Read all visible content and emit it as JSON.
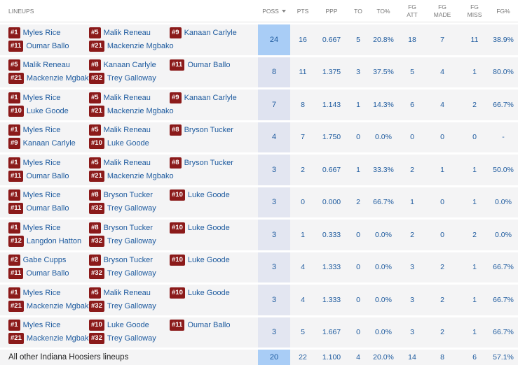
{
  "headers": {
    "lineups": "LINEUPS",
    "poss": "POSS",
    "pts": "PTS",
    "ppp": "PPP",
    "to": "TO",
    "to_pct": "TO%",
    "fg_att_1": "FG",
    "fg_att_2": "ATT",
    "fg_made_1": "FG",
    "fg_made_2": "MADE",
    "fg_miss_1": "FG",
    "fg_miss_2": "MISS",
    "fg_pct": "FG%"
  },
  "colors": {
    "badge": "#8b1a1a",
    "link": "#1d5a9e",
    "poss_highlight": "#a9cdf6",
    "poss_light": "#e6e8f2"
  },
  "lineups": [
    {
      "players": [
        {
          "num": "#1",
          "name": "Myles Rice"
        },
        {
          "num": "#5",
          "name": "Malik Reneau"
        },
        {
          "num": "#9",
          "name": "Kanaan Carlyle"
        },
        {
          "num": "#11",
          "name": "Oumar Ballo"
        },
        {
          "num": "#21",
          "name": "Mackenzie Mgbako"
        }
      ],
      "poss": "24",
      "pts": "16",
      "ppp": "0.667",
      "to": "5",
      "to_pct": "20.8%",
      "fg_att": "18",
      "fg_made": "7",
      "fg_miss": "11",
      "fg_pct": "38.9%"
    },
    {
      "players": [
        {
          "num": "#5",
          "name": "Malik Reneau"
        },
        {
          "num": "#8",
          "name": "Kanaan Carlyle"
        },
        {
          "num": "#11",
          "name": "Oumar Ballo"
        },
        {
          "num": "#21",
          "name": "Mackenzie Mgbako"
        },
        {
          "num": "#32",
          "name": "Trey Galloway"
        }
      ],
      "poss": "8",
      "pts": "11",
      "ppp": "1.375",
      "to": "3",
      "to_pct": "37.5%",
      "fg_att": "5",
      "fg_made": "4",
      "fg_miss": "1",
      "fg_pct": "80.0%"
    },
    {
      "players": [
        {
          "num": "#1",
          "name": "Myles Rice"
        },
        {
          "num": "#5",
          "name": "Malik Reneau"
        },
        {
          "num": "#9",
          "name": "Kanaan Carlyle"
        },
        {
          "num": "#10",
          "name": "Luke Goode"
        },
        {
          "num": "#21",
          "name": "Mackenzie Mgbako"
        }
      ],
      "poss": "7",
      "pts": "8",
      "ppp": "1.143",
      "to": "1",
      "to_pct": "14.3%",
      "fg_att": "6",
      "fg_made": "4",
      "fg_miss": "2",
      "fg_pct": "66.7%"
    },
    {
      "players": [
        {
          "num": "#1",
          "name": "Myles Rice"
        },
        {
          "num": "#5",
          "name": "Malik Reneau"
        },
        {
          "num": "#8",
          "name": "Bryson Tucker"
        },
        {
          "num": "#9",
          "name": "Kanaan Carlyle"
        },
        {
          "num": "#10",
          "name": "Luke Goode"
        }
      ],
      "poss": "4",
      "pts": "7",
      "ppp": "1.750",
      "to": "0",
      "to_pct": "0.0%",
      "fg_att": "0",
      "fg_made": "0",
      "fg_miss": "0",
      "fg_pct": "-"
    },
    {
      "players": [
        {
          "num": "#1",
          "name": "Myles Rice"
        },
        {
          "num": "#5",
          "name": "Malik Reneau"
        },
        {
          "num": "#8",
          "name": "Bryson Tucker"
        },
        {
          "num": "#11",
          "name": "Oumar Ballo"
        },
        {
          "num": "#21",
          "name": "Mackenzie Mgbako"
        }
      ],
      "poss": "3",
      "pts": "2",
      "ppp": "0.667",
      "to": "1",
      "to_pct": "33.3%",
      "fg_att": "2",
      "fg_made": "1",
      "fg_miss": "1",
      "fg_pct": "50.0%"
    },
    {
      "players": [
        {
          "num": "#1",
          "name": "Myles Rice"
        },
        {
          "num": "#8",
          "name": "Bryson Tucker"
        },
        {
          "num": "#10",
          "name": "Luke Goode"
        },
        {
          "num": "#11",
          "name": "Oumar Ballo"
        },
        {
          "num": "#32",
          "name": "Trey Galloway"
        }
      ],
      "poss": "3",
      "pts": "0",
      "ppp": "0.000",
      "to": "2",
      "to_pct": "66.7%",
      "fg_att": "1",
      "fg_made": "0",
      "fg_miss": "1",
      "fg_pct": "0.0%"
    },
    {
      "players": [
        {
          "num": "#1",
          "name": "Myles Rice"
        },
        {
          "num": "#8",
          "name": "Bryson Tucker"
        },
        {
          "num": "#10",
          "name": "Luke Goode"
        },
        {
          "num": "#12",
          "name": "Langdon Hatton"
        },
        {
          "num": "#32",
          "name": "Trey Galloway"
        }
      ],
      "poss": "3",
      "pts": "1",
      "ppp": "0.333",
      "to": "0",
      "to_pct": "0.0%",
      "fg_att": "2",
      "fg_made": "0",
      "fg_miss": "2",
      "fg_pct": "0.0%"
    },
    {
      "players": [
        {
          "num": "#2",
          "name": "Gabe Cupps"
        },
        {
          "num": "#8",
          "name": "Bryson Tucker"
        },
        {
          "num": "#10",
          "name": "Luke Goode"
        },
        {
          "num": "#11",
          "name": "Oumar Ballo"
        },
        {
          "num": "#32",
          "name": "Trey Galloway"
        }
      ],
      "poss": "3",
      "pts": "4",
      "ppp": "1.333",
      "to": "0",
      "to_pct": "0.0%",
      "fg_att": "3",
      "fg_made": "2",
      "fg_miss": "1",
      "fg_pct": "66.7%"
    },
    {
      "players": [
        {
          "num": "#1",
          "name": "Myles Rice"
        },
        {
          "num": "#5",
          "name": "Malik Reneau"
        },
        {
          "num": "#10",
          "name": "Luke Goode"
        },
        {
          "num": "#21",
          "name": "Mackenzie Mgbako"
        },
        {
          "num": "#32",
          "name": "Trey Galloway"
        }
      ],
      "poss": "3",
      "pts": "4",
      "ppp": "1.333",
      "to": "0",
      "to_pct": "0.0%",
      "fg_att": "3",
      "fg_made": "2",
      "fg_miss": "1",
      "fg_pct": "66.7%"
    },
    {
      "players": [
        {
          "num": "#1",
          "name": "Myles Rice"
        },
        {
          "num": "#10",
          "name": "Luke Goode"
        },
        {
          "num": "#11",
          "name": "Oumar Ballo"
        },
        {
          "num": "#21",
          "name": "Mackenzie Mgbako"
        },
        {
          "num": "#32",
          "name": "Trey Galloway"
        }
      ],
      "poss": "3",
      "pts": "5",
      "ppp": "1.667",
      "to": "0",
      "to_pct": "0.0%",
      "fg_att": "3",
      "fg_made": "2",
      "fg_miss": "1",
      "fg_pct": "66.7%"
    }
  ],
  "other": {
    "label": "All other Indiana Hoosiers lineups",
    "poss": "20",
    "pts": "22",
    "ppp": "1.100",
    "to": "4",
    "to_pct": "20.0%",
    "fg_att": "14",
    "fg_made": "8",
    "fg_miss": "6",
    "fg_pct": "57.1%"
  }
}
